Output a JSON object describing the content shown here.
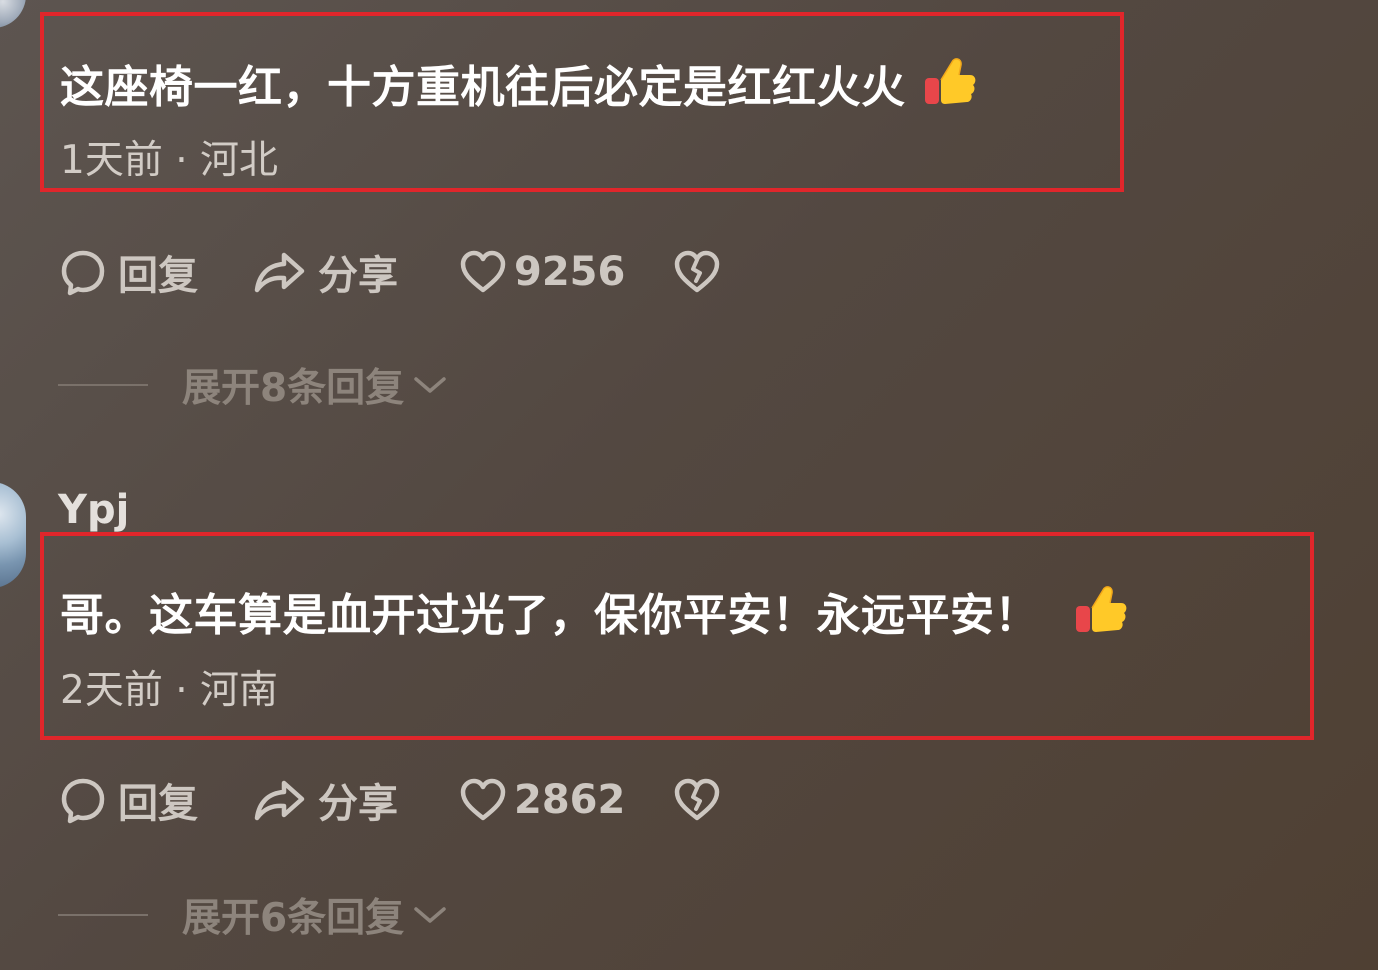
{
  "comments": [
    {
      "username": "",
      "text": "这座椅一红，十方重机往后必定是红红火火",
      "emoji": "thumbs-up-emoji",
      "time": "1天前",
      "separator": "·",
      "location": "河北",
      "reply_label": "回复",
      "share_label": "分享",
      "like_count": "9256",
      "expand_label": "展开8条回复"
    },
    {
      "username": "Ypj",
      "text": "哥。这车算是血开过光了，保你平安！永远平安！",
      "emoji": "thumbs-up-emoji",
      "time": "2天前",
      "separator": "·",
      "location": "河南",
      "reply_label": "回复",
      "share_label": "分享",
      "like_count": "2862",
      "expand_label": "展开6条回复"
    }
  ],
  "highlight_color": "#e0262b",
  "icons": {
    "reply": "comment-bubble-icon",
    "share": "share-arrow-icon",
    "like": "heart-icon",
    "dislike": "broken-heart-icon",
    "expand": "chevron-down-icon"
  }
}
